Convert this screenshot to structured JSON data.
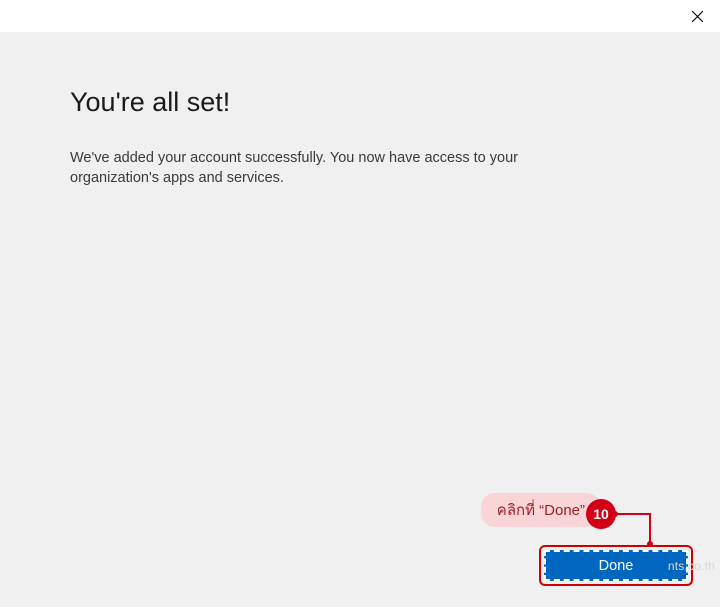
{
  "titlebar": {
    "close_icon": "close"
  },
  "main": {
    "title": "You're all set!",
    "body": "We've added your account successfully. You now have access to your organization's apps and services."
  },
  "footer": {
    "done_label": "Done"
  },
  "annotation": {
    "hint_text": "คลิกที่ “Done”",
    "step_number": "10"
  },
  "watermark": "nts.co.th"
}
